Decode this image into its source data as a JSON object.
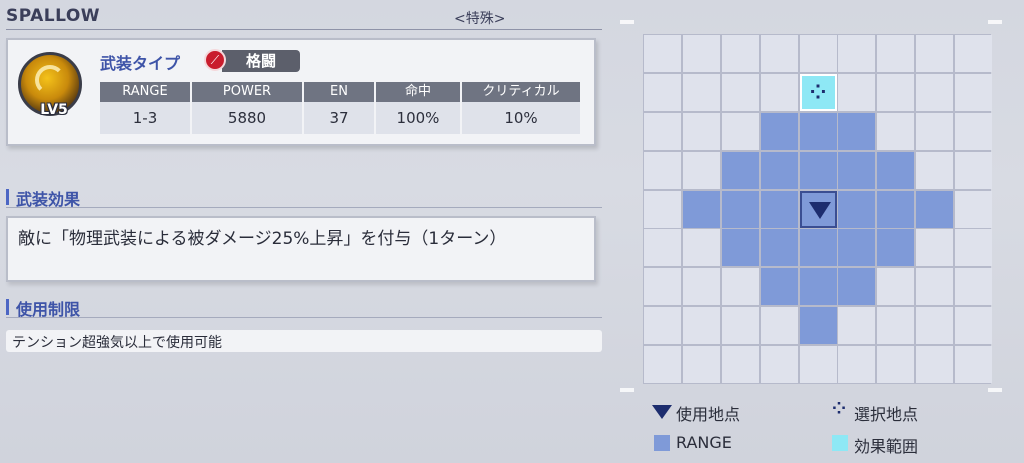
{
  "header": {
    "title": "SPALLOW",
    "subtitle": "<特殊>"
  },
  "weapon": {
    "level": "LV5",
    "type_label": "武装タイプ",
    "type_icon": "slash-icon",
    "type_value": "格闘",
    "stats": [
      {
        "label": "RANGE",
        "value": "1-3"
      },
      {
        "label": "POWER",
        "value": "5880"
      },
      {
        "label": "EN",
        "value": "37"
      },
      {
        "label": "命中",
        "value": "100%"
      },
      {
        "label": "クリティカル",
        "value": "10%"
      }
    ]
  },
  "effect": {
    "heading": "武装効果",
    "text": "敵に「物理武装による被ダメージ25%上昇」を付与（1ターン）"
  },
  "restriction": {
    "heading": "使用制限",
    "text": "テンション超強気以上で使用可能"
  },
  "range_grid": {
    "cols": 9,
    "rows": 9,
    "use_point": [
      4,
      4
    ],
    "select_point": [
      4,
      1
    ],
    "range_cells": [
      [
        3,
        2
      ],
      [
        4,
        2
      ],
      [
        5,
        2
      ],
      [
        2,
        3
      ],
      [
        3,
        3
      ],
      [
        4,
        3
      ],
      [
        5,
        3
      ],
      [
        6,
        3
      ],
      [
        1,
        4
      ],
      [
        2,
        4
      ],
      [
        3,
        4
      ],
      [
        5,
        4
      ],
      [
        6,
        4
      ],
      [
        7,
        4
      ],
      [
        2,
        5
      ],
      [
        3,
        5
      ],
      [
        4,
        5
      ],
      [
        5,
        5
      ],
      [
        6,
        5
      ],
      [
        3,
        6
      ],
      [
        4,
        6
      ],
      [
        5,
        6
      ],
      [
        4,
        7
      ]
    ]
  },
  "legend": {
    "use_point": "使用地点",
    "select_point": "選択地点",
    "range": "RANGE",
    "effect_range": "効果範囲"
  },
  "colors": {
    "range": "#7f9ad8",
    "select": "#8ee8f5",
    "accent": "#3e54a8",
    "marker": "#1d2d6e"
  }
}
